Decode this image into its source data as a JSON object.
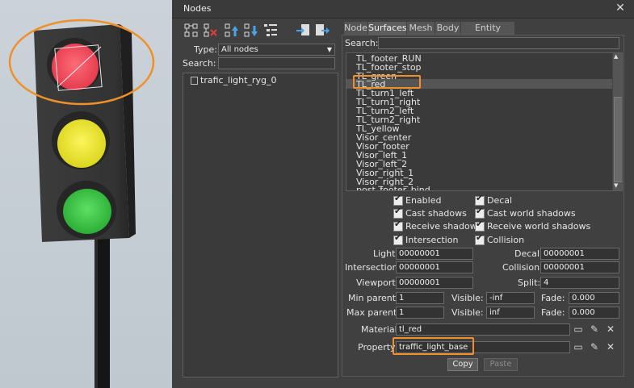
{
  "window": {
    "title": "Nodes",
    "close_glyph": "✕"
  },
  "toolbar": {
    "icons": [
      "node-add-icon",
      "node-delete-icon",
      "move-up-icon",
      "move-down-icon",
      "tree-list-icon",
      "import-icon",
      "export-icon"
    ]
  },
  "filters": {
    "type_label": "Type:",
    "type_value": "All nodes",
    "search_label": "Search:"
  },
  "tree": {
    "items": [
      {
        "label": "trafic_light_ryg_0"
      }
    ]
  },
  "tabs": [
    {
      "label": "Node"
    },
    {
      "label": "Surfaces"
    },
    {
      "label": "Mesh"
    },
    {
      "label": "Body"
    },
    {
      "label": "Entity Fields"
    }
  ],
  "surfaces": {
    "search_label": "Search:",
    "items": [
      "TL_footer_RUN",
      "TL_footer_stop",
      "TL_green",
      "TL_red",
      "TL_turn1_left",
      "TL_turn1_right",
      "TL_turn2_left",
      "TL_turn2_right",
      "TL_yellow",
      "Visor_center",
      "Visor_footer",
      "Visor_left_1",
      "Visor_left_2",
      "Visor_right_1",
      "Visor_right_2",
      "post_footer_bind"
    ],
    "selected": "TL_red"
  },
  "flags": {
    "enabled": "Enabled",
    "decal": "Decal",
    "cast_shadows": "Cast shadows",
    "cast_world_shadows": "Cast world shadows",
    "receive_shadows": "Receive shadows",
    "receive_world_shadows": "Receive world shadows",
    "intersection": "Intersection",
    "collision": "Collision"
  },
  "masks": {
    "light_label": "Light:",
    "light": "00000001",
    "decal_label": "Decal:",
    "decal": "00000001",
    "intersection_label": "Intersection:",
    "intersection": "00000001",
    "collision_label": "Collision:",
    "collision": "00000001",
    "viewport_label": "Viewport:",
    "viewport": "00000001",
    "split_label": "Split:",
    "split": "4"
  },
  "lod": {
    "min_parent_label": "Min parent:",
    "min_parent": "1",
    "min_visible_label": "Visible:",
    "min_visible": "-inf",
    "min_fade_label": "Fade:",
    "min_fade": "0.000",
    "max_parent_label": "Max parent:",
    "max_parent": "1",
    "max_visible_label": "Visible:",
    "max_visible": "inf",
    "max_fade_label": "Fade:",
    "max_fade": "0.000"
  },
  "material": {
    "label": "Material:",
    "value": "tl_red"
  },
  "property": {
    "label": "Property:",
    "value": "traffic_light_base"
  },
  "actions": {
    "copy": "Copy",
    "paste": "Paste"
  },
  "colors": {
    "highlight": "#f0902a",
    "lamp_red": "#f0475b",
    "lamp_yellow": "#f2ec2c",
    "lamp_green": "#3fc64a"
  }
}
